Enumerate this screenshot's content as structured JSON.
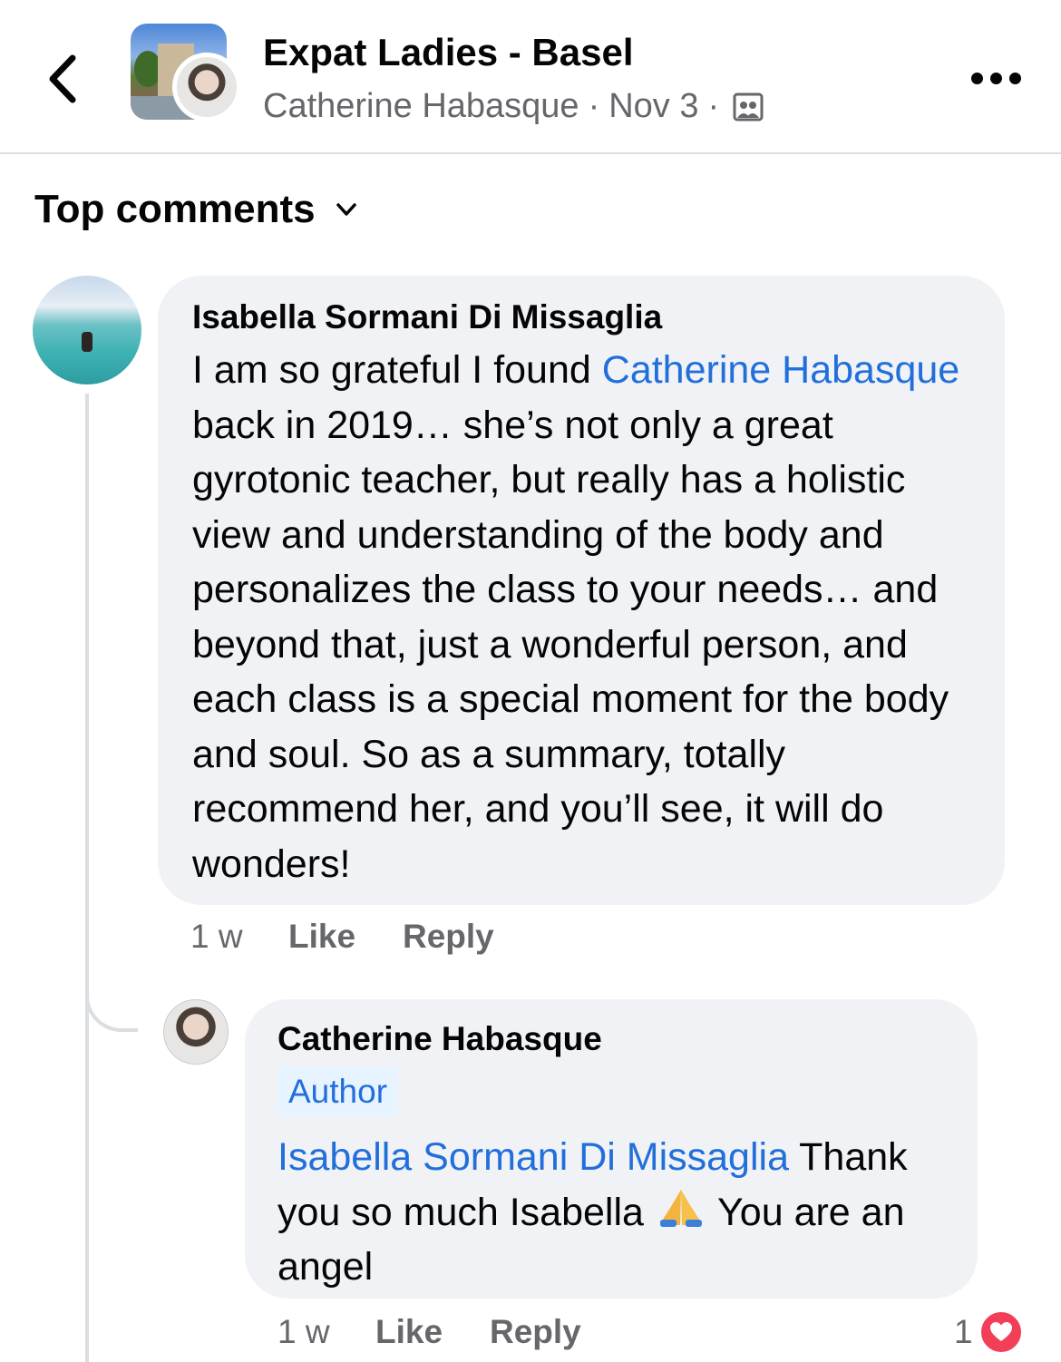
{
  "header": {
    "title": "Expat Ladies - Basel",
    "author": "Catherine Habasque",
    "date": "Nov 3",
    "separator": "·",
    "privacy_icon": "group-members-icon"
  },
  "sort": {
    "label": "Top comments",
    "icon": "chevron-down-icon"
  },
  "comments": [
    {
      "author": "Isabella Sormani Di Missaglia",
      "text_prefix": "I am so grateful I found ",
      "mention": "Catherine Habasque",
      "text_suffix": " back in 2019… she’s not only a great gyrotonic teacher, but really has a holistic view and understanding of the body and personalizes the class to your needs… and beyond that, just a wonderful person, and each class is a special moment for the body and soul. So as a summary, totally recommend her, and you’ll see, it will do wonders!",
      "time": "1 w",
      "like_label": "Like",
      "reply_label": "Reply"
    }
  ],
  "reply": {
    "author": "Catherine Habasque",
    "badge": "Author",
    "mention": "Isabella Sormani Di Missaglia",
    "text_part1": " Thank you so much Isabella ",
    "emoji": "🙏",
    "text_part2": " You are an angel",
    "time": "1 w",
    "like_label": "Like",
    "reply_label": "Reply",
    "reaction_count": "1",
    "reaction_type": "love-icon",
    "reaction_color": "#f33e58"
  },
  "colors": {
    "mention": "#216fdb",
    "bubble": "#f0f2f5",
    "secondary_text": "#65676b"
  }
}
